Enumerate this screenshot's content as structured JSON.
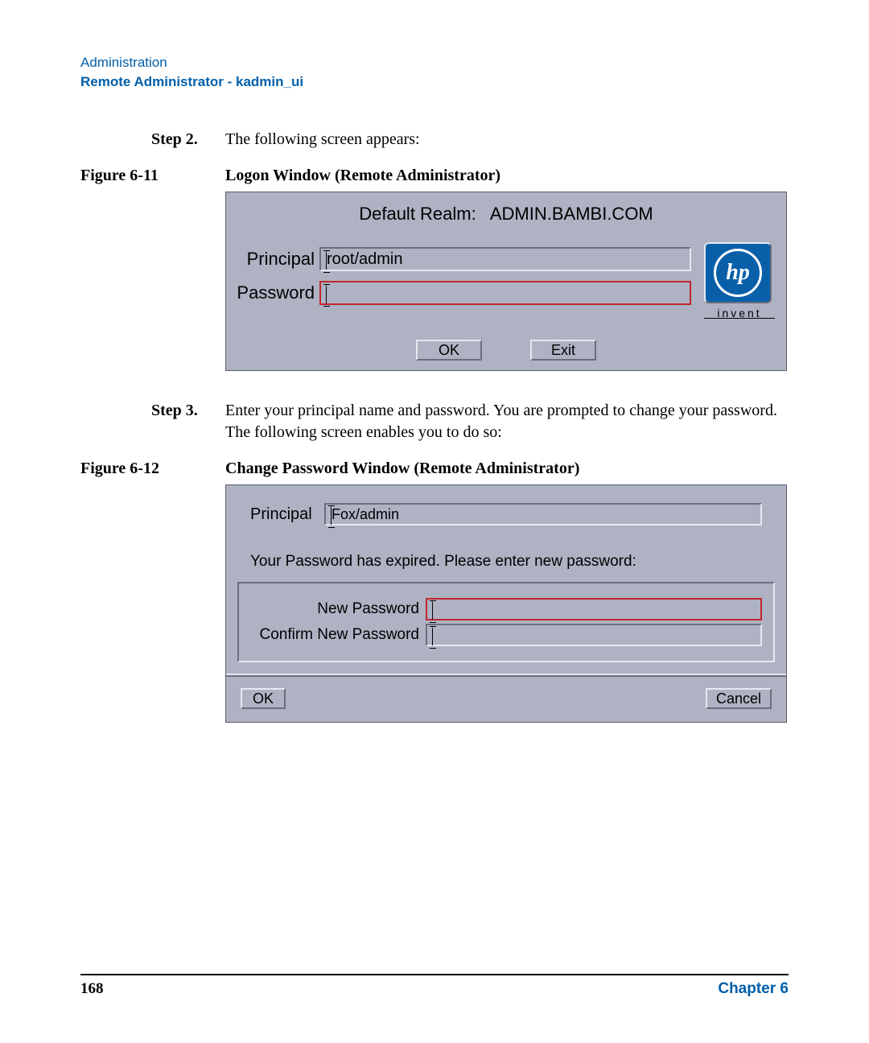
{
  "header": {
    "section": "Administration",
    "subtitle": "Remote Administrator - kadmin_ui"
  },
  "step2": {
    "label": "Step  2.",
    "text": "The following screen appears:"
  },
  "figure611": {
    "label": "Figure 6-11",
    "caption": "Logon Window (Remote Administrator)"
  },
  "logon": {
    "realm_label": "Default Realm:",
    "realm_value": "ADMIN.BAMBI.COM",
    "principal_label": "Principal",
    "principal_value": "root/admin",
    "password_label": "Password",
    "password_value": "",
    "ok": "OK",
    "exit": "Exit",
    "hp_text": "hp",
    "hp_tagline": "invent"
  },
  "step3": {
    "label": "Step  3.",
    "text": "Enter your principal name and password. You are prompted to change your password. The following screen enables you to do so:"
  },
  "figure612": {
    "label": "Figure 6-12",
    "caption": "Change Password Window (Remote Administrator)"
  },
  "chg": {
    "principal_label": "Principal",
    "principal_value": "Fox/admin",
    "expired_msg": "Your Password has expired.  Please enter new password:",
    "newpwd_label": "New Password",
    "confirmpwd_label": "Confirm New Password",
    "newpwd_value": "",
    "confirmpwd_value": "",
    "ok": "OK",
    "cancel": "Cancel"
  },
  "footer": {
    "page": "168",
    "chapter": "Chapter 6"
  }
}
